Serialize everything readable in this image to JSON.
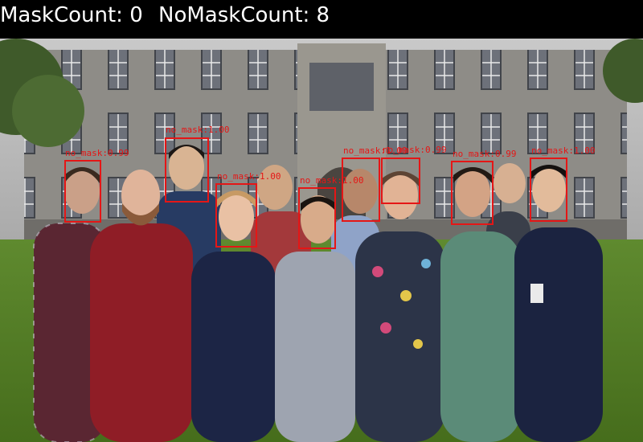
{
  "counter_bar": {
    "mask_count_text": "MaskCount: 0",
    "no_mask_count_text": "NoMaskCount: 8"
  },
  "detections": [
    {
      "label": "no_mask:0.99"
    },
    {
      "label": "no_mask:1.00"
    },
    {
      "label": "no_mask:1.00"
    },
    {
      "label": "no_mask:1.00"
    },
    {
      "label": "no_mask:1.00"
    },
    {
      "label": "no_mask:0.99"
    },
    {
      "label": "no_mask:0.99"
    },
    {
      "label": "no_mask:1.00"
    }
  ],
  "colors": {
    "box": "#e51616",
    "bar_bg": "#000000",
    "bar_text": "#ffffff"
  }
}
